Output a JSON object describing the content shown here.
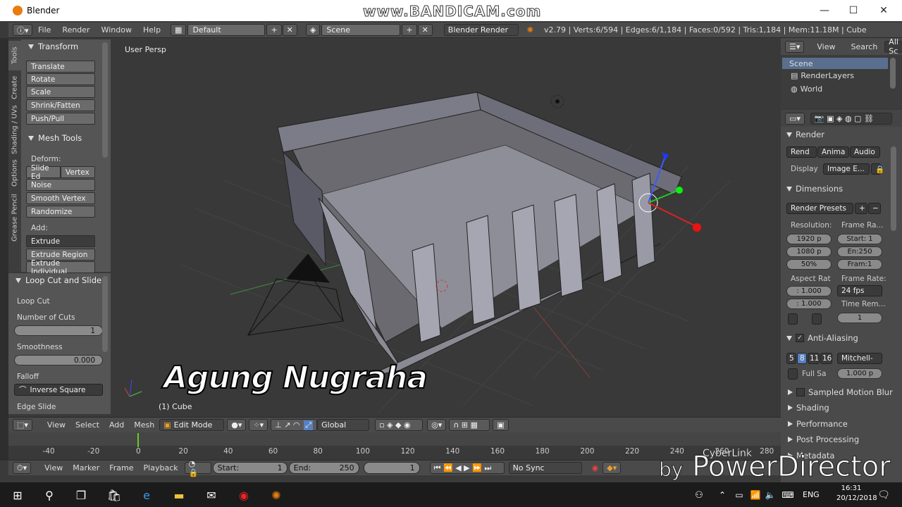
{
  "window": {
    "title": "Blender",
    "minimize": "—",
    "maximize": "☐",
    "close": "✕",
    "recorder": "www.BANDICAM.com"
  },
  "menu": {
    "items": [
      "File",
      "Render",
      "Window",
      "Help"
    ],
    "layout": "Default",
    "scene": "Scene",
    "engine": "Blender Render",
    "stats": "v2.79 | Verts:6/594 | Edges:6/1,184 | Faces:0/592 | Tris:1,184 | Mem:11.18M | Cube"
  },
  "tabs": [
    "Tools",
    "Create",
    "Shading / UVs",
    "Options",
    "Grease Pencil"
  ],
  "toolshelf": {
    "transform_title": "Transform",
    "transform": [
      "Translate",
      "Rotate",
      "Scale",
      "Shrink/Fatten",
      "Push/Pull"
    ],
    "meshtools_title": "Mesh Tools",
    "deform_label": "Deform:",
    "deform_left": "Slide Ed",
    "deform_right": "Vertex",
    "deform_more": [
      "Noise",
      "Smooth Vertex",
      "Randomize"
    ],
    "add_label": "Add:",
    "add_items": [
      "Extrude",
      "Extrude Region",
      "Extrude Individual"
    ]
  },
  "redo": {
    "title": "Loop Cut and Slide",
    "op": "Loop Cut",
    "cuts_label": "Number of Cuts",
    "cuts_value": "1",
    "smooth_label": "Smoothness",
    "smooth_value": "0.000",
    "falloff_label": "Falloff",
    "falloff_value": "Inverse Square",
    "edge_label": "Edge Slide"
  },
  "viewport": {
    "view_name": "User Persp",
    "object": "(1) Cube",
    "overlay": "Agung Nugraha"
  },
  "view_header": {
    "items": [
      "View",
      "Select",
      "Add",
      "Mesh"
    ],
    "mode": "Edit Mode",
    "orientation": "Global"
  },
  "timeline": {
    "ticks": [
      "-40",
      "-20",
      "0",
      "20",
      "40",
      "60",
      "80",
      "100",
      "120",
      "140",
      "160",
      "180",
      "200",
      "220",
      "240",
      "260",
      "280"
    ],
    "current_frame": 0
  },
  "timeline_header": {
    "items": [
      "View",
      "Marker",
      "Frame",
      "Playback"
    ],
    "start_label": "Start:",
    "start": "1",
    "end_label": "End:",
    "end": "250",
    "current": "1",
    "sync": "No Sync"
  },
  "outliner": {
    "header": [
      "View",
      "Search",
      "All Sc"
    ],
    "items": [
      "Scene",
      "RenderLayers",
      "World"
    ]
  },
  "properties": {
    "render_title": "Render",
    "render_btns": [
      "Rend",
      "Anima",
      "Audio"
    ],
    "display_label": "Display",
    "display_value": "Image E...",
    "dimensions_title": "Dimensions",
    "presets": "Render Presets",
    "resolution_label": "Resolution:",
    "res_x": "1920 p",
    "res_y": "1080 p",
    "res_pct": "50%",
    "framerange_label": "Frame Ra...",
    "start": "Start: 1",
    "end": "En:250",
    "frame": "Fram:1",
    "aspect_label": "Aspect Rat",
    "aspect_x": ": 1.000",
    "aspect_y": ": 1.000",
    "framerate_label": "Frame Rate:",
    "fps": "24 fps",
    "timerem_label": "Time Rem...",
    "timerem": "1",
    "aa_title": "Anti-Aliasing",
    "aa_samples": [
      "5",
      "8",
      "11",
      "16"
    ],
    "aa_filter": "Mitchell-",
    "fullsample": "Full Sa",
    "filter_size": "1.000 p",
    "panels": [
      "Sampled Motion Blur",
      "Shading",
      "Performance",
      "Post Processing",
      "Metadata"
    ]
  },
  "branding": {
    "cyberlink": "CyberLink",
    "by": "by",
    "powerdirector": "PowerDirector"
  },
  "taskbar": {
    "lang": "ENG",
    "time": "16:31",
    "date": "20/12/2018"
  }
}
